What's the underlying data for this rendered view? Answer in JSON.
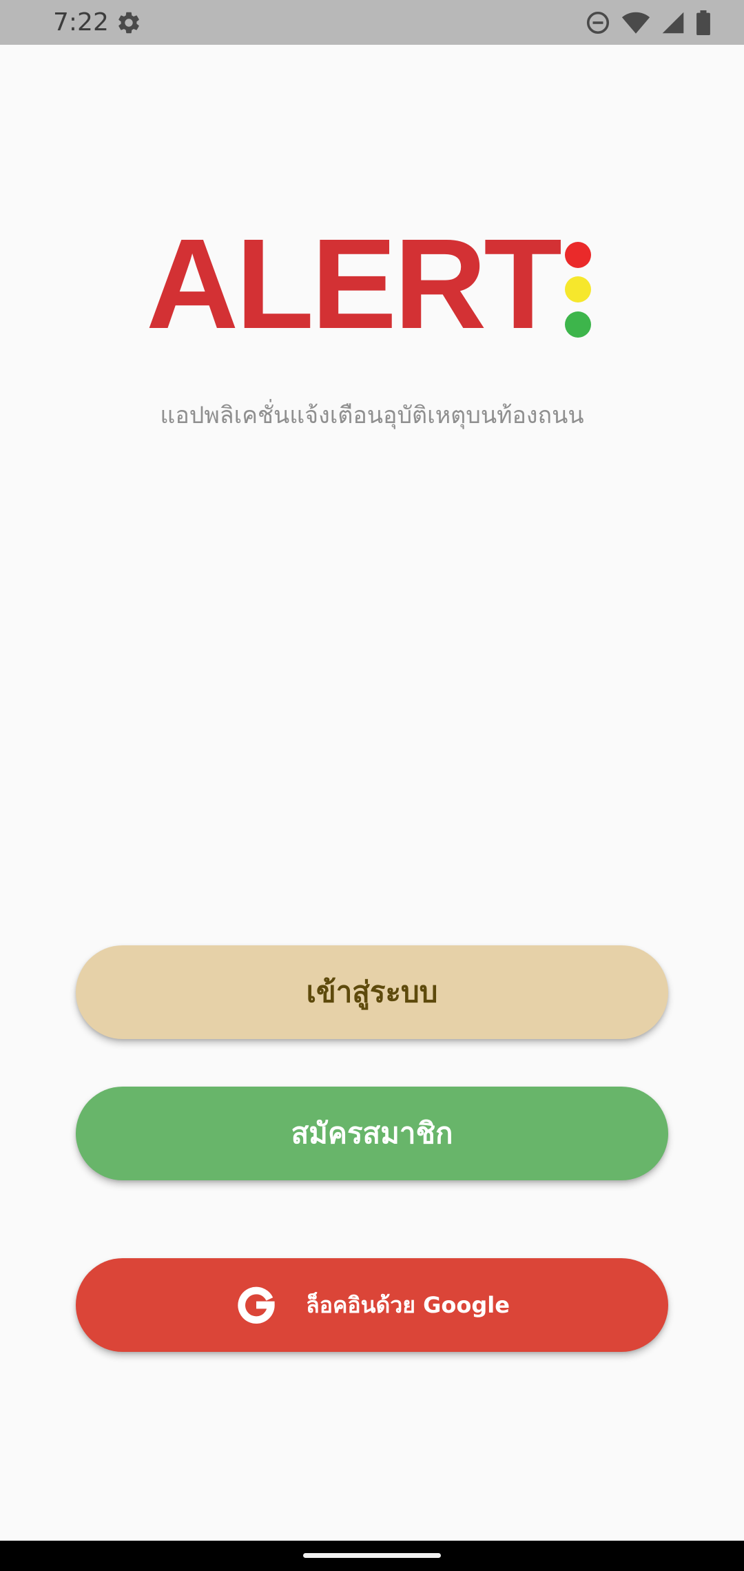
{
  "status_bar": {
    "time": "7:22",
    "icons": [
      "settings-icon",
      "do-not-disturb-icon",
      "wifi-icon",
      "signal-icon",
      "battery-icon"
    ]
  },
  "logo": {
    "text": "ALERT",
    "lights": [
      "#ea2a2a",
      "#f6e72c",
      "#3db54b"
    ],
    "color": "#d33134"
  },
  "tagline": "แอปพลิเคชั่นแจ้งเตือนอุบัติเหตุบนท้องถนน",
  "buttons": {
    "login": "เข้าสู่ระบบ",
    "register": "สมัครสมาชิก",
    "google": "ล็อคอินด้วย Google"
  },
  "colors": {
    "login_bg": "#e6d1a8",
    "register_bg": "#68b56a",
    "google_bg": "#db4538"
  }
}
